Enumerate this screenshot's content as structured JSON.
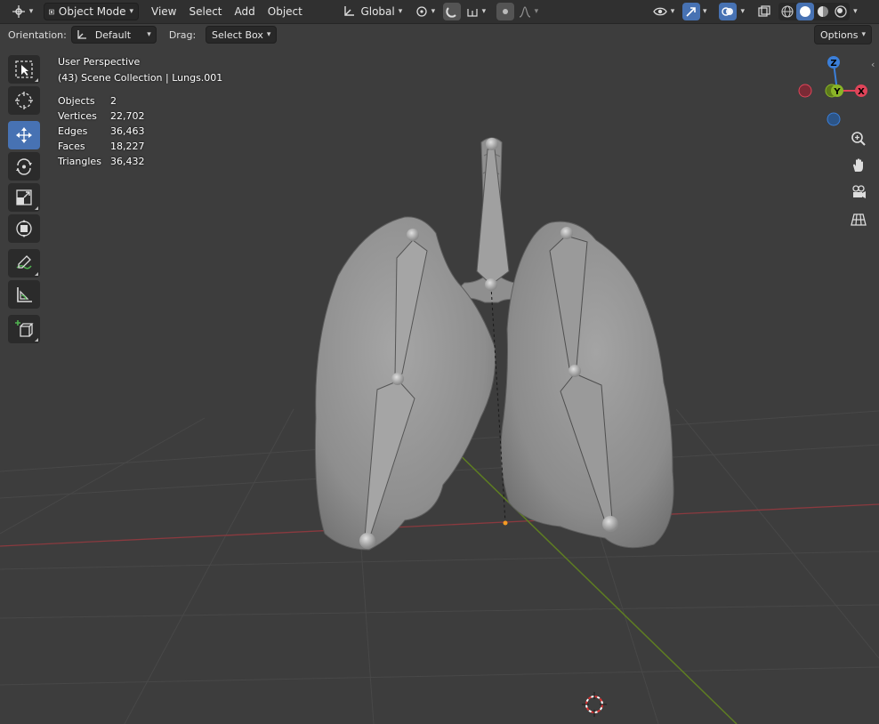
{
  "header": {
    "mode_label": "Object Mode",
    "menus": [
      "View",
      "Select",
      "Add",
      "Object"
    ],
    "transform_orientation": "Global"
  },
  "toolrow": {
    "orientation_label": "Orientation:",
    "orientation_value": "Default",
    "drag_label": "Drag:",
    "drag_value": "Select Box",
    "options_label": "Options"
  },
  "overlay": {
    "perspective": "User Perspective",
    "collection": "(43) Scene Collection | Lungs.001",
    "stats": [
      {
        "label": "Objects",
        "value": "2"
      },
      {
        "label": "Vertices",
        "value": "22,702"
      },
      {
        "label": "Edges",
        "value": "36,463"
      },
      {
        "label": "Faces",
        "value": "18,227"
      },
      {
        "label": "Triangles",
        "value": "36,432"
      }
    ]
  },
  "gizmo": {
    "z_label": "Z",
    "y_label": "Y",
    "x_label": "X",
    "colors": {
      "x": "#e04459",
      "y": "#8ab527",
      "z": "#3b7fd9"
    }
  },
  "theme": {
    "accent": "#4772b3",
    "header_bg": "#303030",
    "viewport_bg": "#3d3d3d"
  }
}
